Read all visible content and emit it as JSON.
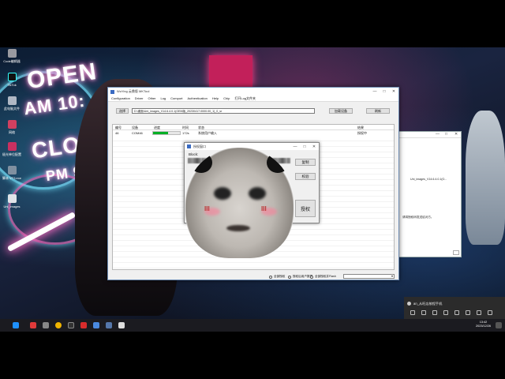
{
  "desktop": {
    "neon_text": [
      "OPEN",
      "AM 10:",
      "CLOS",
      "PM 9"
    ],
    "icons": [
      {
        "label": "Code编辑器",
        "color": "#9a9aa0"
      },
      {
        "label": "TikTok",
        "color": "#111111"
      },
      {
        "label": "此电脑文件",
        "color": "#b0b8c4"
      },
      {
        "label": "网络",
        "color": "#d04060"
      },
      {
        "label": "极光单位配置",
        "color": "#c83060"
      },
      {
        "label": "脚本 VT3.exe",
        "color": "#8090a0"
      },
      {
        "label": "Uni_images",
        "color": "#dfe3e8"
      }
    ]
  },
  "main_window": {
    "title": "WuYing 云鼎版 MKTool",
    "menu": [
      "Configuration",
      "Driver",
      "Other",
      "Log",
      "Comport",
      "Authentication",
      "Help",
      "Chip",
      "打开Log文件夹"
    ],
    "select_label": "选择",
    "path_value": "D:\\桌面\\Uni_images_V14.6.4.0.1(OEM版_20230417.0000.00_1)_0_sr",
    "load_label": "加载设备",
    "refresh_label": "刷新",
    "table_headers": [
      "编号",
      "设备",
      "进度",
      "时间",
      "状态",
      "结果"
    ],
    "rows": [
      {
        "id": "46",
        "device": "COM46",
        "progress": 0.55,
        "time": "172s",
        "status": "系统用户输入",
        "result": "授权中"
      }
    ],
    "bottom_options": [
      "全部授权",
      "授权后用户数据",
      "全部授权并Flash"
    ]
  },
  "dialog": {
    "title": "授权窗口",
    "field_label": "Block:",
    "copy_label": "复制",
    "verify_label": "校验",
    "authorize_label": "授权",
    "meme_marks": [
      "III",
      "III"
    ]
  },
  "side_window": {
    "path_text": "Uni_images_V14.6.4.0.1(O...",
    "note_text": "请将授权码发送给对方。"
  },
  "notification": {
    "text": "an_从旺店按程手机"
  },
  "taskbar": {
    "time": "13:42",
    "date": "2023/12/26"
  }
}
